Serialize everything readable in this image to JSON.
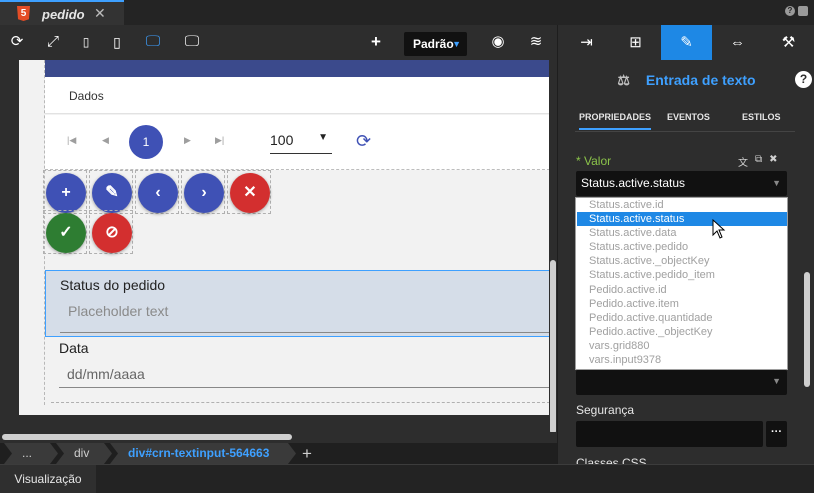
{
  "tab": {
    "title": "pedido",
    "icon": "html5-icon"
  },
  "toolbar": {
    "preset_label": "Padrão"
  },
  "canvas": {
    "data_tab": "Dados",
    "pager": {
      "current": "1",
      "page_size": "100"
    },
    "status_label": "Status do pedido",
    "status_placeholder": "Placeholder text",
    "date_label": "Data",
    "date_placeholder": "dd/mm/aaaa"
  },
  "breadcrumb": {
    "items": [
      "...",
      "div",
      "div#crn-textinput-564663"
    ]
  },
  "statusbar": {
    "view_label": "Visualização"
  },
  "panel": {
    "title": "Entrada de texto",
    "subtabs": [
      "PROPRIEDADES",
      "EVENTOS",
      "ESTILOS"
    ],
    "value_label": "* Valor",
    "value_selected": "Status.active.status",
    "security_label": "Segurança",
    "classes_label": "Classes CSS",
    "accent": "#1e88e5"
  },
  "dropdown": {
    "options": [
      "Status.active.id",
      "Status.active.status",
      "Status.active.data",
      "Status.active.pedido",
      "Status.active._objectKey",
      "Status.active.pedido_item",
      "Pedido.active.id",
      "Pedido.active.item",
      "Pedido.active.quantidade",
      "Pedido.active._objectKey",
      "vars.grid880",
      "vars.input9378"
    ]
  }
}
